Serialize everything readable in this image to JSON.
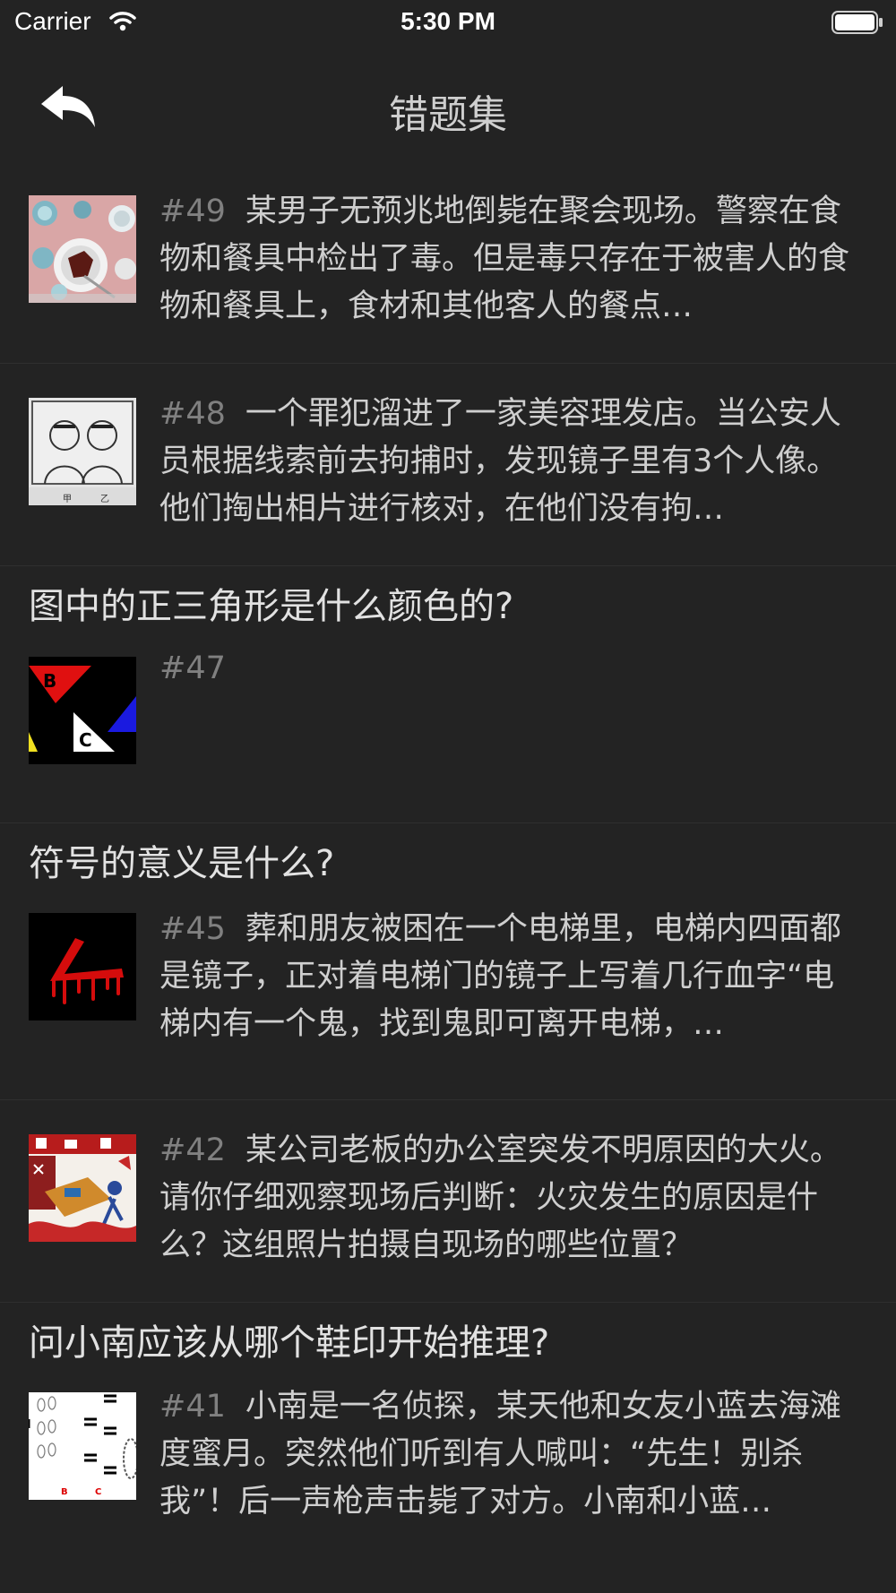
{
  "status_bar": {
    "carrier": "Carrier",
    "time": "5:30 PM"
  },
  "nav": {
    "title": "错题集"
  },
  "sections": {
    "s47": {
      "title": "图中的正三角形是什么颜色的?"
    },
    "s45": {
      "title": "符号的意义是什么?"
    },
    "s41": {
      "title": "问小南应该从哪个鞋印开始推理?"
    }
  },
  "items": {
    "i49": {
      "number": "#49",
      "text": "某男子无预兆地倒毙在聚会现场。警察在食物和餐具中检出了毒。但是毒只存在于被害人的食物和餐具上，食材和其他客人的餐点…"
    },
    "i48": {
      "number": "#48",
      "text": "一个罪犯溜进了一家美容理发店。当公安人员根据线索前去拘捕时，发现镜子里有3个人像。他们掏出相片进行核对，在他们没有拘…"
    },
    "i47": {
      "number": "#47",
      "text": "",
      "thumb_labels": [
        "B",
        "C"
      ]
    },
    "i45": {
      "number": "#45",
      "text": "葬和朋友被困在一个电梯里，电梯内四面都是镜子，正对着电梯门的镜子上写着几行血字“电梯内有一个鬼，找到鬼即可离开电梯，…"
    },
    "i42": {
      "number": "#42",
      "text": "某公司老板的办公室突发不明原因的大火。请你仔细观察现场后判断：火灾发生的原因是什么？这组照片拍摄自现场的哪些位置？"
    },
    "i41": {
      "number": "#41",
      "text": "小南是一名侦探，某天他和女友小蓝去海滩度蜜月。突然他们听到有人喊叫：“先生！别杀我”！后一声枪声击毙了对方。小南和小蓝…",
      "thumb_labels": [
        "B",
        "C"
      ]
    }
  }
}
